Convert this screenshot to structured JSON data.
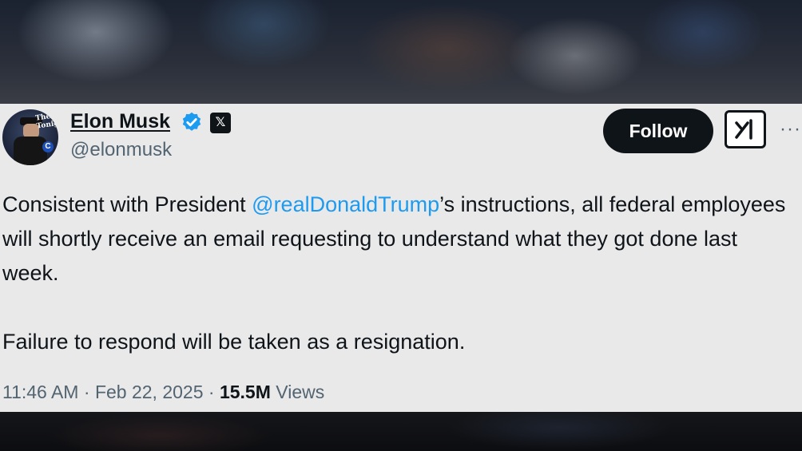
{
  "author": {
    "display_name": "Elon Musk",
    "handle": "@elonmusk",
    "avatar_badge_text": "The Tonight",
    "avatar_corner_letter": "C"
  },
  "badges": {
    "verified_icon": "verified-check-icon",
    "affiliate_icon": "x-logo-icon"
  },
  "actions": {
    "follow_label": "Follow",
    "grok_icon": "grok-icon",
    "more_icon": "more-dots-icon"
  },
  "tweet": {
    "line1_before_mention": "Consistent with President ",
    "mention": "@realDonaldTrump",
    "line1_after_mention": "’s instructions, all federal employees will shortly receive an email requesting to understand what they got done last week.",
    "paragraph2": "Failure to respond will be taken as a resignation."
  },
  "meta": {
    "time": "11:46 AM",
    "separator": "·",
    "date": "Feb 22, 2025",
    "views_count": "15.5M",
    "views_label": "Views"
  },
  "colors": {
    "accent": "#1d9bf0",
    "text": "#0f1419",
    "muted": "#536471",
    "card_bg": "#e9e9ea"
  }
}
